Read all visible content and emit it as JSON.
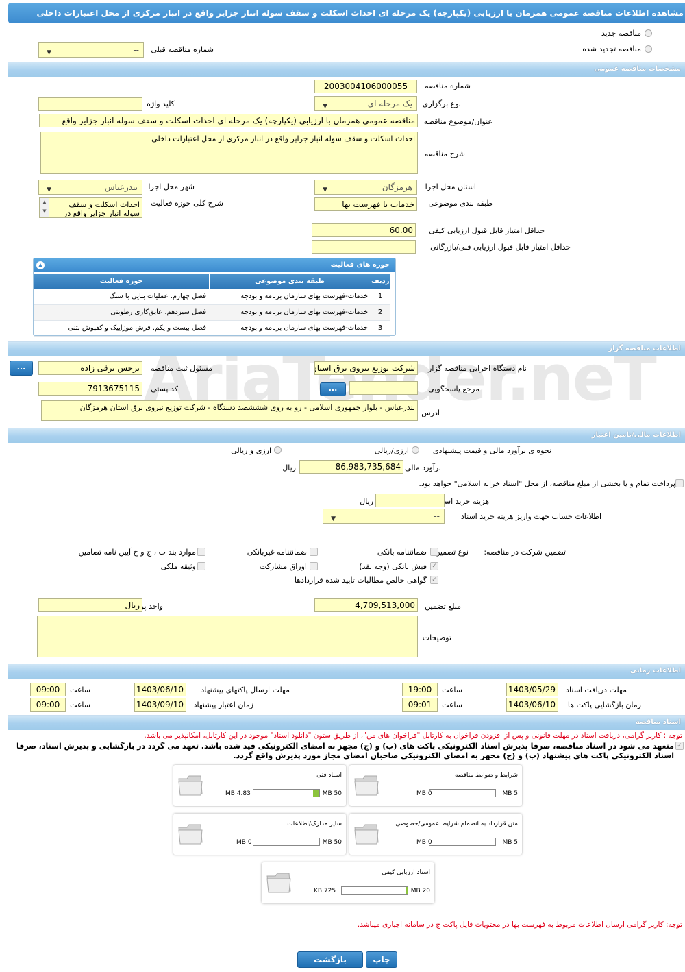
{
  "title": "مشاهده اطلاعات مناقصه عمومی همزمان با ارزیابی (یکپارچه) یک مرحله ای احداث اسکلت و سقف سوله انبار جزایر واقع در انبار مرکزی از محل اعتبارات داخلی",
  "radios": {
    "new": "مناقصه جدید",
    "renewed": "مناقصه تجدید شده",
    "prev_label": "شماره مناقصه قبلی",
    "prev_value": "--"
  },
  "sections": {
    "general": "مشخصات مناقصه عمومی",
    "organizer": "اطلاعات مناقصه گزار",
    "finance": "اطلاعات مالی/تامین اعتبار",
    "time": "اطلاعات زمانی",
    "docs": "اسناد مناقصه"
  },
  "general": {
    "number_label": "شماره مناقصه",
    "number": "2003004106000055",
    "type_label": "نوع برگزاری",
    "type": "یک مرحله ای",
    "keyword_label": "کلید واژه",
    "keyword": "",
    "subject_label": "عنوان/موضوع مناقصه",
    "subject": "مناقصه عمومی همزمان با ارزیابی (یکپارچه) یک مرحله ای احداث اسکلت و سقف سوله انبار جزایر واقع",
    "desc_label": "شرح مناقصه",
    "desc": "احداث اسکلت و سقف سوله انبار جزایر واقع در انبار مرکزي از محل اعتبارات داخلی",
    "province_label": "استان محل اجرا",
    "province": "هرمزگان",
    "city_label": "شهر محل اجرا",
    "city": "بندرعباس",
    "category_label": "طبقه بندی موضوعی",
    "category": "خدمات با فهرست بها",
    "scope_label": "شرح کلی حوزه فعالیت",
    "scope": "احداث اسکلت و سقف سوله انبار جزایر واقع در",
    "min_quality_label": "حداقل امتیاز قابل قبول ارزیابی کیفی",
    "min_quality": "60.00",
    "min_tech_label": "حداقل امتیاز قابل قبول ارزیابی فنی/بازرگانی",
    "min_tech": ""
  },
  "activities": {
    "title": "حوزه های فعالیت",
    "headers": [
      "ردیف",
      "طبقه بندی موضوعی",
      "حوزه فعالیت"
    ],
    "rows": [
      [
        "1",
        "خدمات-فهرست بهای سازمان برنامه و بودجه",
        "فصل چهارم. عملیات بنایی با سنگ"
      ],
      [
        "2",
        "خدمات-فهرست بهای سازمان برنامه و بودجه",
        "فصل سیزدهم. عایق‌کاری رطوبتی"
      ],
      [
        "3",
        "خدمات-فهرست بهای سازمان برنامه و بودجه",
        "فصل بیست و یکم. فرش موزاییک و کفپوش بتنی"
      ]
    ]
  },
  "organizer": {
    "org_label": "نام دستگاه اجرایی مناقصه گزار",
    "org": "شرکت توزیع نیروی برق استان",
    "resp_label": "مسئول ثبت مناقصه",
    "resp": "نرجس برقی زاده",
    "ref_label": "مرجع پاسخگویی",
    "ref": "",
    "postal_label": "کد پستی",
    "postal": "7913675115",
    "address_label": "آدرس",
    "address": "بندرعباس - بلوار جمهوری اسلامی - رو به روی شششصد دستگاه - شرکت توزیع نیروی برق استان هرمزگان",
    "more": "..."
  },
  "finance": {
    "method_label": "نحوه ی برآورد مالی و قیمت پیشنهادی",
    "opt1": "ارزی/ریالی",
    "opt2": "ارزی و ریالی",
    "estimate_label": "برآورد مالی",
    "estimate": "86,983,735,684",
    "rial": "ریال",
    "treasury": "پرداخت تمام و یا بخشی از مبلغ مناقصه، از محل \"اسناد خزانه اسلامی\" خواهد بود.",
    "doc_cost_label": "هزینه خرید اسناد",
    "doc_cost": "",
    "account_label": "اطلاعات حساب جهت واریز هزینه خرید اسناد",
    "account": "--"
  },
  "guarantee": {
    "label": "تضمین شرکت در مناقصه:",
    "type_label": "نوع تضمین",
    "opts": [
      "ضمانتنامه بانکی",
      "ضمانتنامه غیربانکی",
      "موارد بند ب ، ج و خ آیین نامه تضامین",
      "فیش بانکی (وجه نقد)",
      "اوراق مشارکت",
      "وثیقه ملکی",
      "گواهی خالص مطالبات تایید شده قراردادها"
    ],
    "amount_label": "مبلغ تضمین",
    "amount": "4,709,513,000",
    "unit_label": "واحد پول",
    "unit": "ریال",
    "notes_label": "توضیحات",
    "notes": ""
  },
  "time": {
    "recv_label": "مهلت دریافت اسناد",
    "recv_date": "1403/05/29",
    "recv_time": "19:00",
    "send_label": "مهلت ارسال پاکتهای پیشنهاد",
    "send_date": "1403/06/10",
    "send_time": "09:00",
    "open_label": "زمان بازگشایی پاکت ها",
    "open_date": "1403/06/10",
    "open_time": "09:01",
    "valid_label": "زمان اعتبار پیشنهاد",
    "valid_date": "1403/09/10",
    "valid_time": "09:00",
    "hour": "ساعت"
  },
  "docs": {
    "note1": "توجه : کاربر گرامی، دریافت اسناد در مهلت قانونی و پس از افزودن فراخوان به کارتابل \"فراخوان های من\"، از طریق ستون \"دانلود اسناد\" موجود در این کارتابل، امکانپذیر می باشد.",
    "commit": "متعهد می شود در اسناد مناقصه، صرفاً پذیرش اسناد الکترونیکی پاکت های (ب) و (ج) مجهز به امضای الکترونیکی قید شده باشد. تعهد می گردد در بازگشایی و پذیرش اسناد، صرفاً اسناد الکترونیکی پاکت های پیشنهاد (ب) و (ج) مجهز به امضای الکترونیکی صاحبان امضای مجاز مورد پذیرش واقع گردد.",
    "files": [
      {
        "name": "شرایط و ضوابط مناقصه",
        "size": "0 MB",
        "max": "5 MB",
        "fill": 0
      },
      {
        "name": "اسناد فنی",
        "size": "4.83 MB",
        "max": "50 MB",
        "fill": 0.097
      },
      {
        "name": "متن قرارداد به انضمام شرایط عمومی/خصوصی",
        "size": "0 MB",
        "max": "5 MB",
        "fill": 0
      },
      {
        "name": "سایر مدارک/اطلاعات",
        "size": "0 MB",
        "max": "50 MB",
        "fill": 0
      },
      {
        "name": "اسناد ارزیابی کیفی",
        "size": "725 KB",
        "max": "20 MB",
        "fill": 0.035
      }
    ],
    "note2": "توجه: کاربر گرامی ارسال اطلاعات مربوط به فهرست بها در محتویات فایل پاکت ج در سامانه اجباری میباشد."
  },
  "buttons": {
    "print": "چاپ",
    "back": "بازگشت"
  },
  "watermark": "AriaTender.neT"
}
